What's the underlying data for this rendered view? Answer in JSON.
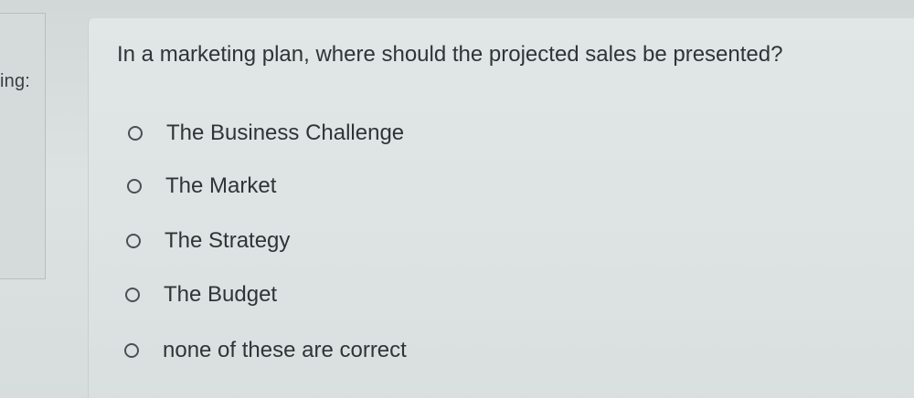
{
  "sidebar": {
    "label": "ing:"
  },
  "question": {
    "text": "In a marketing plan, where should the projected sales be presented?",
    "options": [
      {
        "label": "The Business Challenge"
      },
      {
        "label": "The Market"
      },
      {
        "label": "The Strategy"
      },
      {
        "label": "The Budget"
      },
      {
        "label": "none of these are correct"
      }
    ]
  }
}
